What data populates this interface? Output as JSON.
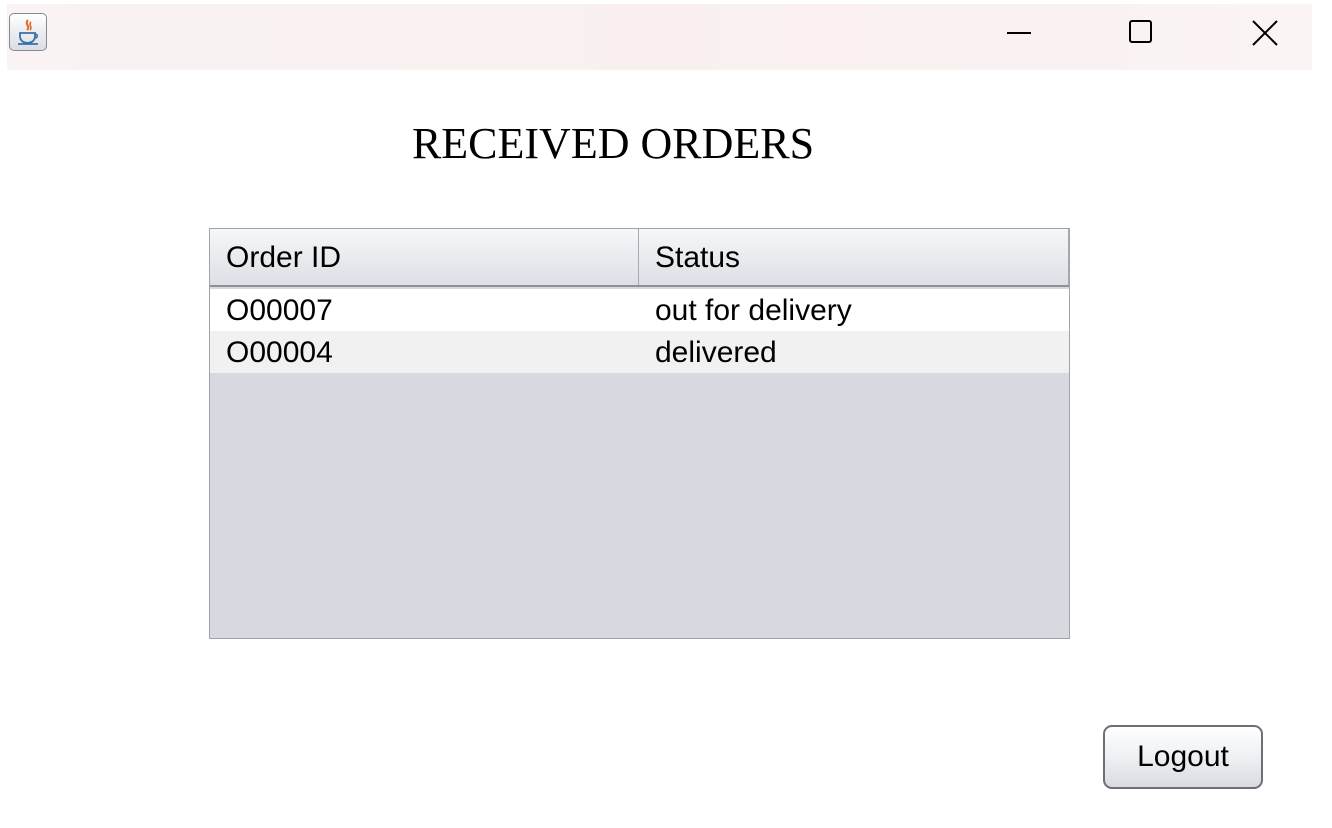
{
  "window": {
    "icon": "java-cup-icon",
    "controls": {
      "minimize_icon": "minimize-icon",
      "maximize_icon": "maximize-icon",
      "close_icon": "close-icon"
    }
  },
  "heading": "RECEIVED ORDERS",
  "orders_table": {
    "columns": [
      "Order ID",
      "Status"
    ],
    "rows": [
      {
        "order_id": "O00007",
        "status": "out for delivery"
      },
      {
        "order_id": "O00004",
        "status": "delivered"
      }
    ]
  },
  "actions": {
    "logout_label": "Logout"
  },
  "colors": {
    "table_empty_area": "#d6d9e0",
    "alt_row": "#f1f1f2",
    "titlebar": "#f9f1f1"
  }
}
